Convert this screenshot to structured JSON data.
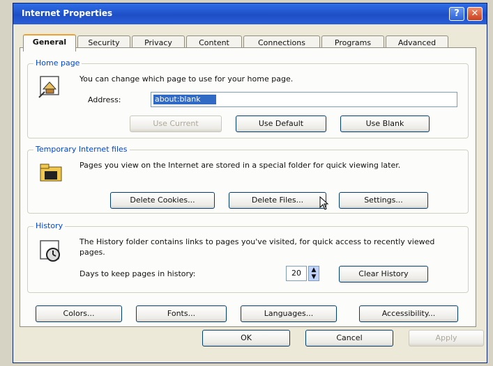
{
  "window": {
    "title": "Internet Properties",
    "help_glyph": "?",
    "close_glyph": "✕"
  },
  "tabs": [
    {
      "label": "General",
      "active": true
    },
    {
      "label": "Security",
      "active": false
    },
    {
      "label": "Privacy",
      "active": false
    },
    {
      "label": "Content",
      "active": false
    },
    {
      "label": "Connections",
      "active": false
    },
    {
      "label": "Programs",
      "active": false
    },
    {
      "label": "Advanced",
      "active": false
    }
  ],
  "home_page": {
    "label": "Home page",
    "description": "You can change which page to use for your home page.",
    "address_label": "Address:",
    "address_value": "about:blank",
    "use_current": "Use Current",
    "use_default": "Use Default",
    "use_blank": "Use Blank"
  },
  "temp_files": {
    "label": "Temporary Internet files",
    "description": "Pages you view on the Internet are stored in a special folder for quick viewing later.",
    "delete_cookies": "Delete Cookies...",
    "delete_files": "Delete Files...",
    "settings": "Settings..."
  },
  "history": {
    "label": "History",
    "description": "The History folder contains links to pages you've visited, for quick access to recently viewed pages.",
    "days_label": "Days to keep pages in history:",
    "days_value": "20",
    "clear_history": "Clear History"
  },
  "bottom_buttons": {
    "colors": "Colors...",
    "fonts": "Fonts...",
    "languages": "Languages...",
    "accessibility": "Accessibility..."
  },
  "footer": {
    "ok": "OK",
    "cancel": "Cancel",
    "apply": "Apply"
  },
  "colors": {
    "titlebar": "#1e4ec6",
    "group_label": "#0046d5",
    "selection": "#316ac5",
    "dialog_bg": "#ece9d8"
  }
}
